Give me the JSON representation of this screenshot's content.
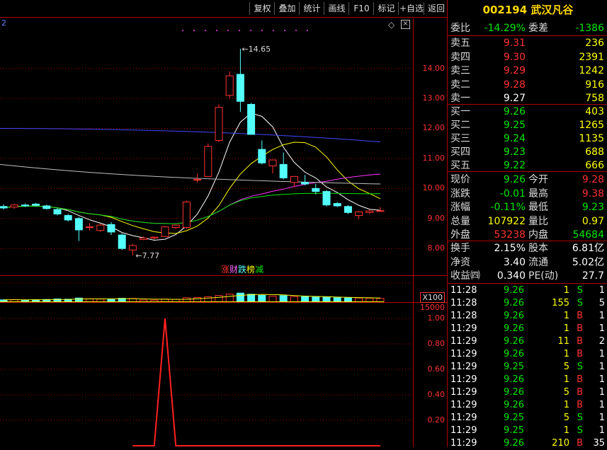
{
  "toolbar": {
    "buttons": [
      "复权",
      "叠加",
      "统计",
      "画线",
      "F10",
      "标记",
      "+自选",
      "返回"
    ]
  },
  "stock": {
    "code": "002194",
    "name": "武汉凡谷"
  },
  "chart_label_left": "2",
  "order_ratio": {
    "label1": "委比",
    "value1": "-14.29%",
    "label2": "委差",
    "value2": "-1386"
  },
  "asks": [
    {
      "label": "卖五",
      "price": "9.31",
      "vol": "236"
    },
    {
      "label": "卖四",
      "price": "9.30",
      "vol": "2391"
    },
    {
      "label": "卖三",
      "price": "9.29",
      "vol": "1242"
    },
    {
      "label": "卖二",
      "price": "9.28",
      "vol": "916"
    },
    {
      "label": "卖一",
      "price": "9.27",
      "vol": "758"
    }
  ],
  "bids": [
    {
      "label": "买一",
      "price": "9.26",
      "vol": "403"
    },
    {
      "label": "买二",
      "price": "9.25",
      "vol": "1265"
    },
    {
      "label": "买三",
      "price": "9.24",
      "vol": "1135"
    },
    {
      "label": "买四",
      "price": "9.23",
      "vol": "688"
    },
    {
      "label": "买五",
      "price": "9.22",
      "vol": "666"
    }
  ],
  "stats1": [
    {
      "l1": "现价",
      "v1": "9.26",
      "c1": "green",
      "l2": "今开",
      "v2": "9.28",
      "c2": "red"
    },
    {
      "l1": "涨跌",
      "v1": "-0.01",
      "c1": "green",
      "l2": "最高",
      "v2": "9.38",
      "c2": "red"
    },
    {
      "l1": "涨幅",
      "v1": "-0.11%",
      "c1": "green",
      "l2": "最低",
      "v2": "9.23",
      "c2": "green"
    },
    {
      "l1": "总量",
      "v1": "107922",
      "c1": "yellow",
      "l2": "量比",
      "v2": "0.97",
      "c2": "yellow"
    },
    {
      "l1": "外盘",
      "v1": "53238",
      "c1": "red",
      "l2": "内盘",
      "v2": "54684",
      "c2": "green"
    }
  ],
  "stats2": [
    {
      "l1": "换手",
      "v1": "2.15%",
      "l2": "股本",
      "v2": "6.81亿"
    },
    {
      "l1": "净资",
      "v1": "3.40",
      "l2": "流通",
      "v2": "5.02亿"
    },
    {
      "l1": "收益㈣",
      "v1": "0.340",
      "l2": "PE(动)",
      "v2": "27.7"
    }
  ],
  "ticks": [
    {
      "time": "11:28",
      "price": "9.26",
      "vol": "1",
      "side": "S",
      "n": "1"
    },
    {
      "time": "11:28",
      "price": "9.26",
      "vol": "155",
      "side": "S",
      "n": "5"
    },
    {
      "time": "11:28",
      "price": "9.26",
      "vol": "1",
      "side": "B",
      "n": "1"
    },
    {
      "time": "11:29",
      "price": "9.26",
      "vol": "1",
      "side": "B",
      "n": "1"
    },
    {
      "time": "11:29",
      "price": "9.26",
      "vol": "11",
      "side": "B",
      "n": "2"
    },
    {
      "time": "11:29",
      "price": "9.26",
      "vol": "1",
      "side": "B",
      "n": "1"
    },
    {
      "time": "11:29",
      "price": "9.25",
      "vol": "5",
      "side": "S",
      "n": "1"
    },
    {
      "time": "11:29",
      "price": "9.26",
      "vol": "1",
      "side": "B",
      "n": "1"
    },
    {
      "time": "11:29",
      "price": "9.26",
      "vol": "5",
      "side": "B",
      "n": "1"
    },
    {
      "time": "11:29",
      "price": "9.26",
      "vol": "1",
      "side": "B",
      "n": "1"
    },
    {
      "time": "11:29",
      "price": "9.25",
      "vol": "5",
      "side": "S",
      "n": "1"
    },
    {
      "time": "11:29",
      "price": "9.25",
      "vol": "1",
      "side": "S",
      "n": "1"
    },
    {
      "time": "11:29",
      "price": "9.26",
      "vol": "210",
      "side": "B",
      "n": "35"
    }
  ],
  "main_axis": [
    "14.00",
    "13.00",
    "12.00",
    "11.00",
    "10.00",
    "9.00",
    "8.00"
  ],
  "vol_axis": {
    "top": "15000",
    "unit": "X100"
  },
  "ind_axis": [
    "1.00",
    "0.80",
    "0.60",
    "0.40",
    "0.20"
  ],
  "annotations": {
    "high": "14.65",
    "low": "7.77"
  },
  "tags": [
    {
      "text": "涨",
      "color": "#ff3232"
    },
    {
      "text": "财",
      "color": "#ff66ff"
    },
    {
      "text": "跌",
      "color": "#54ffff"
    },
    {
      "text": "榜",
      "color": "#ffff00"
    },
    {
      "text": "减",
      "color": "#00e600"
    }
  ],
  "colors": {
    "up": "#ff3232",
    "down": "#54ffff",
    "bg": "#000000",
    "grid": "#b00000"
  },
  "candles": [
    {
      "o": 9.4,
      "h": 9.47,
      "l": 9.3,
      "c": 9.35
    },
    {
      "o": 9.38,
      "h": 9.48,
      "l": 9.32,
      "c": 9.45
    },
    {
      "o": 9.45,
      "h": 9.5,
      "l": 9.38,
      "c": 9.42
    },
    {
      "o": 9.48,
      "h": 9.52,
      "l": 9.4,
      "c": 9.44
    },
    {
      "o": 9.42,
      "h": 9.46,
      "l": 9.3,
      "c": 9.33
    },
    {
      "o": 9.3,
      "h": 9.34,
      "l": 9.1,
      "c": 9.15
    },
    {
      "o": 9.1,
      "h": 9.15,
      "l": 8.9,
      "c": 8.95
    },
    {
      "o": 9.0,
      "h": 9.05,
      "l": 8.25,
      "c": 8.62
    },
    {
      "o": 8.7,
      "h": 8.85,
      "l": 8.6,
      "c": 8.72
    },
    {
      "o": 8.6,
      "h": 8.82,
      "l": 8.55,
      "c": 8.78
    },
    {
      "o": 8.8,
      "h": 8.88,
      "l": 8.45,
      "c": 8.55
    },
    {
      "o": 8.45,
      "h": 8.5,
      "l": 7.95,
      "c": 8.0
    },
    {
      "o": 7.95,
      "h": 8.15,
      "l": 7.77,
      "c": 8.1
    },
    {
      "o": 8.3,
      "h": 8.4,
      "l": 8.28,
      "c": 8.35
    },
    {
      "o": 8.35,
      "h": 8.4,
      "l": 8.3,
      "c": 8.38
    },
    {
      "o": 8.4,
      "h": 8.75,
      "l": 8.38,
      "c": 8.72
    },
    {
      "o": 8.7,
      "h": 8.8,
      "l": 8.65,
      "c": 8.78
    },
    {
      "o": 8.7,
      "h": 9.6,
      "l": 8.65,
      "c": 9.55
    },
    {
      "o": 10.28,
      "h": 10.5,
      "l": 10.2,
      "c": 10.3
    },
    {
      "o": 10.4,
      "h": 11.5,
      "l": 10.4,
      "c": 11.4
    },
    {
      "o": 11.6,
      "h": 12.8,
      "l": 11.55,
      "c": 12.7
    },
    {
      "o": 13.1,
      "h": 13.9,
      "l": 13.0,
      "c": 13.75
    },
    {
      "o": 13.8,
      "h": 14.65,
      "l": 12.55,
      "c": 12.9
    },
    {
      "o": 12.8,
      "h": 12.85,
      "l": 11.8,
      "c": 11.8
    },
    {
      "o": 11.3,
      "h": 11.6,
      "l": 10.8,
      "c": 10.85
    },
    {
      "o": 10.75,
      "h": 10.95,
      "l": 10.5,
      "c": 10.95
    },
    {
      "o": 10.8,
      "h": 11.2,
      "l": 10.3,
      "c": 10.35
    },
    {
      "o": 10.2,
      "h": 10.4,
      "l": 10.05,
      "c": 10.4
    },
    {
      "o": 10.2,
      "h": 10.45,
      "l": 10.1,
      "c": 10.15
    },
    {
      "o": 10.0,
      "h": 10.15,
      "l": 9.8,
      "c": 9.9
    },
    {
      "o": 9.9,
      "h": 9.95,
      "l": 9.4,
      "c": 9.45
    },
    {
      "o": 9.5,
      "h": 9.55,
      "l": 9.38,
      "c": 9.42
    },
    {
      "o": 9.4,
      "h": 9.45,
      "l": 9.15,
      "c": 9.2
    },
    {
      "o": 9.1,
      "h": 9.25,
      "l": 8.98,
      "c": 9.22
    },
    {
      "o": 9.2,
      "h": 9.3,
      "l": 9.15,
      "c": 9.25
    },
    {
      "o": 9.26,
      "h": 9.38,
      "l": 9.23,
      "c": 9.26
    }
  ],
  "volumes": [
    1800,
    2000,
    1700,
    1900,
    2100,
    2500,
    2300,
    3200,
    2600,
    2400,
    2500,
    3000,
    2900,
    1600,
    1500,
    2400,
    2200,
    3400,
    3600,
    4200,
    5200,
    6300,
    7100,
    6200,
    5300,
    4600,
    5100,
    4400,
    4200,
    4000,
    3800,
    3500,
    3300,
    3200,
    3100,
    2900
  ],
  "indicator": [
    0,
    0,
    0,
    0,
    0,
    0,
    0,
    0,
    0,
    0,
    0,
    0,
    0,
    0,
    0,
    1,
    0,
    0,
    0,
    0,
    0,
    0,
    0,
    0,
    0,
    0,
    0,
    0,
    0,
    0,
    0,
    0,
    0,
    0,
    0,
    0
  ]
}
